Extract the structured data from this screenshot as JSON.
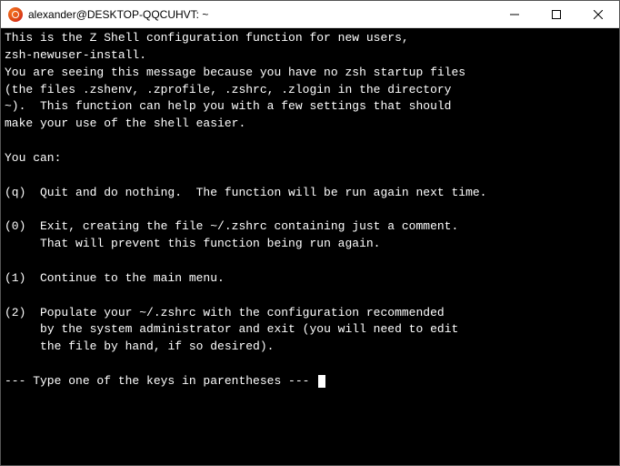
{
  "window": {
    "title": "alexander@DESKTOP-QQCUHVT: ~"
  },
  "terminal": {
    "line1": "This is the Z Shell configuration function for new users,",
    "line2": "zsh-newuser-install.",
    "line3": "You are seeing this message because you have no zsh startup files",
    "line4": "(the files .zshenv, .zprofile, .zshrc, .zlogin in the directory",
    "line5": "~).  This function can help you with a few settings that should",
    "line6": "make your use of the shell easier.",
    "blank1": "",
    "line7": "You can:",
    "blank2": "",
    "line8": "(q)  Quit and do nothing.  The function will be run again next time.",
    "blank3": "",
    "line9": "(0)  Exit, creating the file ~/.zshrc containing just a comment.",
    "line10": "     That will prevent this function being run again.",
    "blank4": "",
    "line11": "(1)  Continue to the main menu.",
    "blank5": "",
    "line12": "(2)  Populate your ~/.zshrc with the configuration recommended",
    "line13": "     by the system administrator and exit (you will need to edit",
    "line14": "     the file by hand, if so desired).",
    "blank6": "",
    "prompt": "--- Type one of the keys in parentheses --- "
  }
}
